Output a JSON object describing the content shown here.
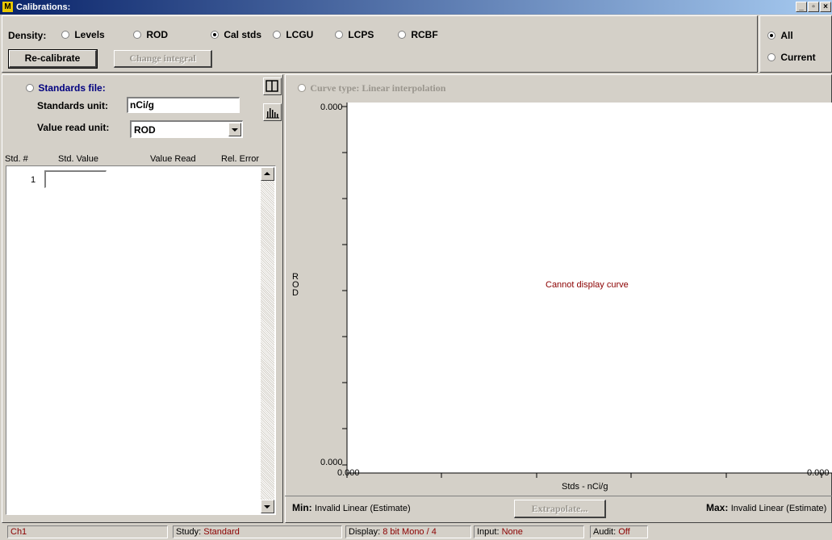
{
  "window": {
    "title": "Calibrations:",
    "app_icon_letter": "M",
    "minimize_label": "_",
    "maximize_label": "▫",
    "close_label": "×"
  },
  "density": {
    "label": "Density:",
    "options": [
      {
        "label": "Levels",
        "selected": false
      },
      {
        "label": "ROD",
        "selected": false
      },
      {
        "label": "Cal stds",
        "selected": true
      },
      {
        "label": "LCGU",
        "selected": false
      },
      {
        "label": "LCPS",
        "selected": false
      },
      {
        "label": "RCBF",
        "selected": false
      }
    ]
  },
  "scope": {
    "options": [
      {
        "label": "All",
        "selected": true
      },
      {
        "label": "Current",
        "selected": false
      }
    ]
  },
  "buttons": {
    "recalibrate": "Re-calibrate",
    "change_integral": "Change integral",
    "extrapolate": "Extrapolate..."
  },
  "standards": {
    "file_label": "Standards file:",
    "unit_label": "Standards unit:",
    "unit_value": "nCi/g",
    "read_unit_label": "Value read unit:",
    "read_unit_value": "ROD",
    "columns": [
      "Std. #",
      "Std. Value",
      "Value Read",
      "Rel. Error"
    ],
    "rows": [
      {
        "num": "1",
        "value": ""
      }
    ]
  },
  "curve": {
    "type_label": "Curve type: Linear interpolation",
    "message": "Cannot display curve",
    "ylabel": "ROD",
    "xlabel": "Stds - nCi/g",
    "y_top": "0.000",
    "y_bottom": "0.000",
    "x_left": "0.000",
    "x_right": "0.000",
    "min_label": "Min:",
    "min_value": "Invalid Linear (Estimate)",
    "max_label": "Max:",
    "max_value": "Invalid Linear (Estimate)"
  },
  "status": {
    "channel": "Ch1",
    "study_label": "Study:",
    "study_value": "Standard",
    "display_label": "Display:",
    "display_value": "8 bit Mono / 4",
    "input_label": "Input:",
    "input_value": "None",
    "audit_label": "Audit:",
    "audit_value": "Off"
  },
  "colors": {
    "title_start": "#0a246a",
    "title_end": "#a6caf0",
    "chrome": "#d4d0c8",
    "accent_text": "#000080",
    "status_value": "#8b0000"
  }
}
